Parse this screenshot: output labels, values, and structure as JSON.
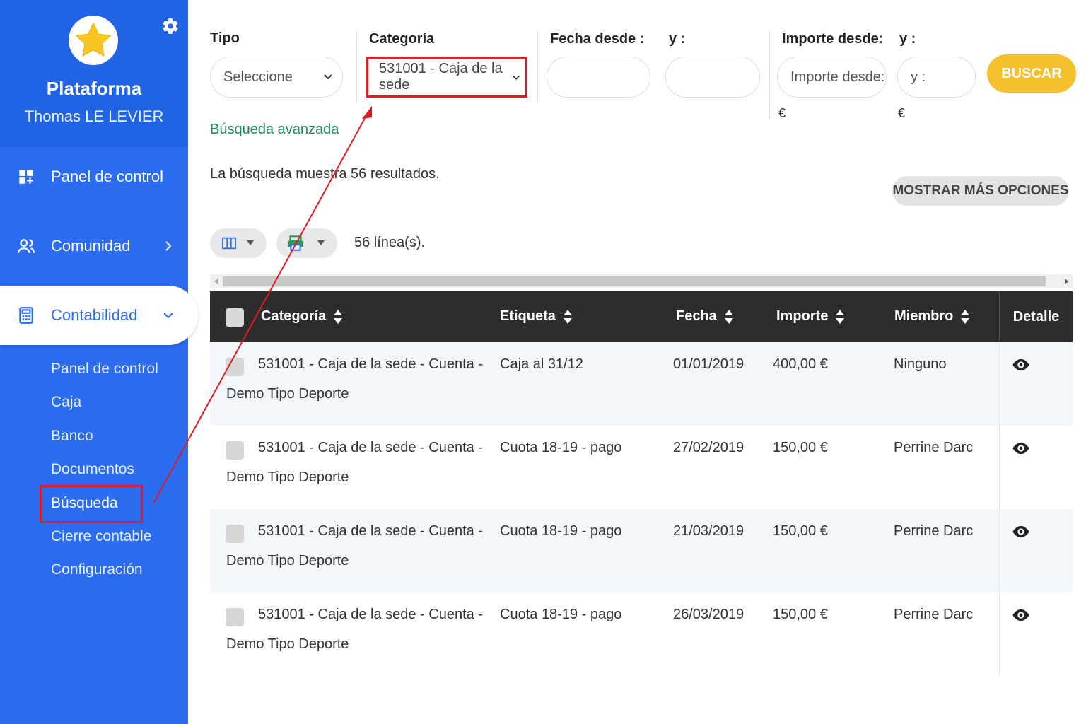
{
  "sidebar": {
    "brand": "Plataforma",
    "user": "Thomas LE LEVIER",
    "nav": {
      "panel": "Panel de control",
      "comunidad": "Comunidad",
      "contabilidad": "Contabilidad"
    },
    "sub": [
      "Panel de control",
      "Caja",
      "Banco",
      "Documentos",
      "Búsqueda",
      "Cierre contable",
      "Configuración"
    ]
  },
  "filters": {
    "tipo_label": "Tipo",
    "tipo_value": "Seleccione",
    "categoria_label": "Categoría",
    "categoria_value": "531001 - Caja de la sede",
    "fecha_label": "Fecha desde :",
    "fecha_y_label": "y :",
    "importe_label": "Importe desde:",
    "importe_y_label": "y :",
    "importe_placeholder": "Importe desde:",
    "importe_y_placeholder": "y :",
    "currency": "€",
    "search_button": "BUSCAR",
    "advanced_link": "Búsqueda avanzada"
  },
  "results_text": "La búsqueda muestra 56 resultados.",
  "more_options": "MOSTRAR MÁS OPCIONES",
  "lines_count": "56 línea(s).",
  "table": {
    "headers": [
      "Categoría",
      "Etiqueta",
      "Fecha",
      "Importe",
      "Miembro",
      "Detalle"
    ],
    "rows": [
      {
        "cat1": "531001 - Caja de la sede - Cuenta -",
        "cat2": "Demo Tipo Deporte",
        "etiqueta": "Caja al 31/12",
        "fecha": "01/01/2019",
        "importe": "400,00 €",
        "miembro": "Ninguno"
      },
      {
        "cat1": "531001 - Caja de la sede - Cuenta -",
        "cat2": "Demo Tipo Deporte",
        "etiqueta": "Cuota 18-19 - pago",
        "fecha": "27/02/2019",
        "importe": "150,00 €",
        "miembro": "Perrine Darc"
      },
      {
        "cat1": "531001 - Caja de la sede - Cuenta -",
        "cat2": "Demo Tipo Deporte",
        "etiqueta": "Cuota 18-19 - pago",
        "fecha": "21/03/2019",
        "importe": "150,00 €",
        "miembro": "Perrine Darc"
      },
      {
        "cat1": "531001 - Caja de la sede - Cuenta -",
        "cat2": "Demo Tipo Deporte",
        "etiqueta": "Cuota 18-19 - pago",
        "fecha": "26/03/2019",
        "importe": "150,00 €",
        "miembro": "Perrine Darc"
      }
    ]
  },
  "colors": {
    "sidebar": "#2b6cf0",
    "accent": "#f5c02e",
    "highlight": "#e01b24",
    "table_header": "#2d2d2d"
  }
}
